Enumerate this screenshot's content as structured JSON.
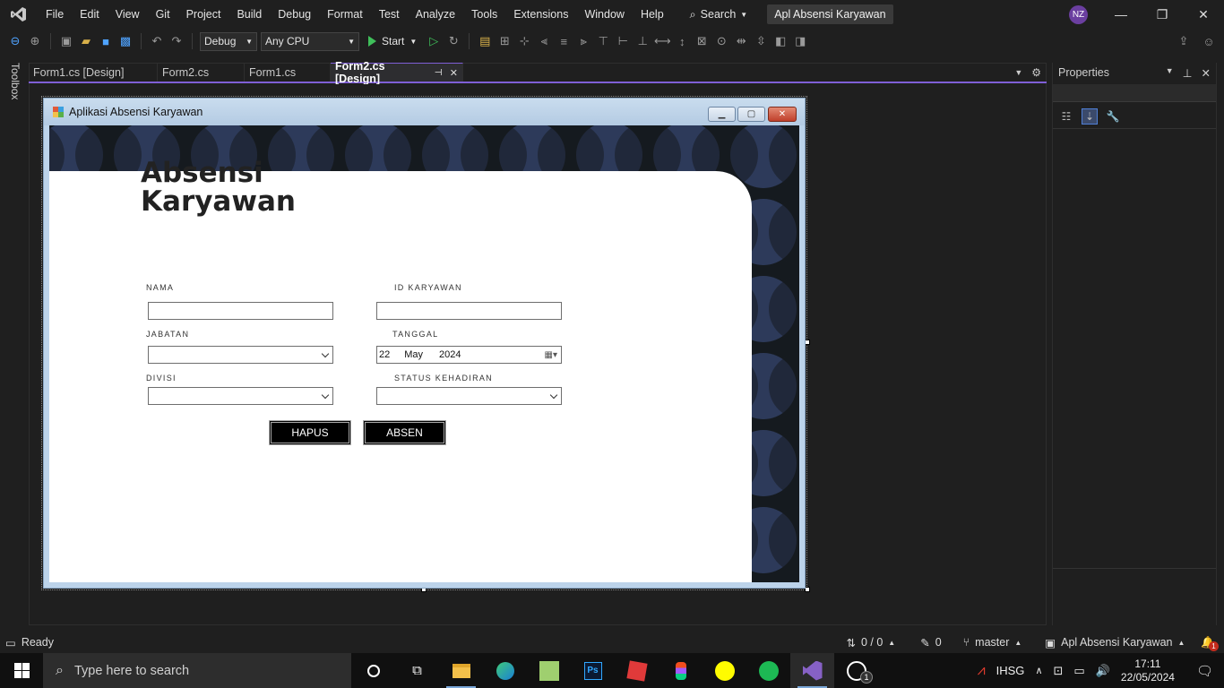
{
  "menubar": {
    "items": [
      "File",
      "Edit",
      "View",
      "Git",
      "Project",
      "Build",
      "Debug",
      "Format",
      "Test",
      "Analyze",
      "Tools",
      "Extensions",
      "Window",
      "Help"
    ],
    "search_label": "Search",
    "solution_name": "Apl Absensi Karyawan",
    "avatar_initials": "NZ"
  },
  "toolbar": {
    "config": "Debug",
    "platform": "Any CPU",
    "start_label": "Start"
  },
  "toolbox_label": "Toolbox",
  "tabs": [
    {
      "label": "Form1.cs [Design]"
    },
    {
      "label": "Form2.cs"
    },
    {
      "label": "Form1.cs"
    },
    {
      "label": "Form2.cs [Design]"
    }
  ],
  "form": {
    "title": "Aplikasi Absensi Karyawan",
    "heading_line1": "Absensi",
    "heading_line2": "Karyawan",
    "labels": {
      "nama": "NAMA",
      "id_karyawan": "ID KARYAWAN",
      "jabatan": "JABATAN",
      "tanggal": "TANGGAL",
      "divisi": "DIVISI",
      "status_kehadiran": "STATUS KEHADIRAN"
    },
    "date": {
      "day": "22",
      "month": "May",
      "year": "2024"
    },
    "buttons": {
      "hapus": "HAPUS",
      "absen": "ABSEN"
    },
    "colors": {
      "pattern_bg": "#151a1f",
      "pattern_circle": "#2d3a5a",
      "card": "#ffffff",
      "button": "#000000"
    }
  },
  "properties": {
    "title": "Properties"
  },
  "statusbar": {
    "ready": "Ready",
    "lines": "0 / 0",
    "edits": "0",
    "branch": "master",
    "project": "Apl Absensi Karyawan",
    "notif_count": "1"
  },
  "taskbar": {
    "search_placeholder": "Type here to search",
    "stock_label": "IHSG",
    "time": "17:11",
    "date": "22/05/2024",
    "whatsapp_badge": "1"
  },
  "colors": {
    "accent": "#7f5fd6",
    "vs_bg": "#1f1f1f",
    "link_blue": "#4fa3ff"
  }
}
